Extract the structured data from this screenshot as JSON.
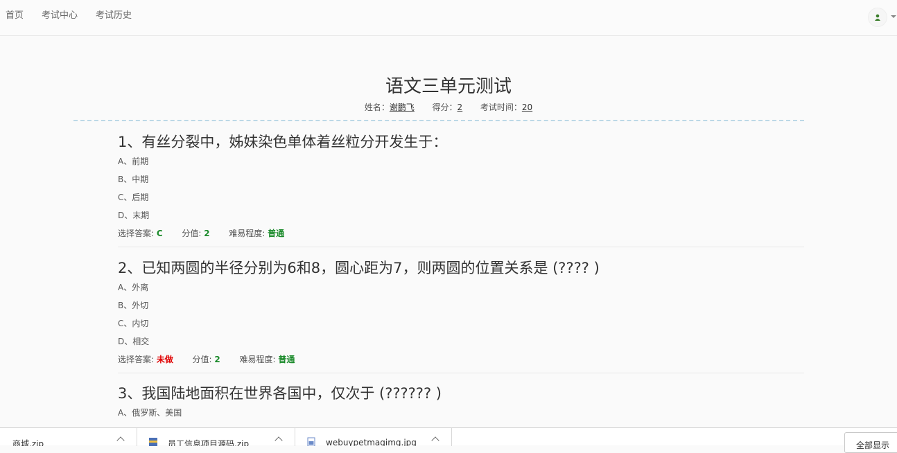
{
  "nav": {
    "home": "首页",
    "exam_center": "考试中心",
    "exam_history": "考试历史"
  },
  "exam": {
    "title": "语文三单元测试",
    "name_label": "姓名：",
    "name_value": "谢鹏飞",
    "score_label": "得分：",
    "score_value": "2",
    "time_label": "考试时间：",
    "time_value": "20"
  },
  "labels": {
    "selected_answer": "选择答案:",
    "score": "分值:",
    "difficulty": "难易程度:"
  },
  "questions": [
    {
      "title": "1、有丝分裂中，姊妹染色单体着丝粒分开发生于：",
      "options": [
        "A、前期",
        "B、中期",
        "C、后期",
        "D、末期"
      ],
      "answer": "C",
      "score": "2",
      "difficulty": "普通"
    },
    {
      "title": "2、已知两圆的半径分别为6和8，圆心距为7，则两圆的位置关系是 (???? )",
      "options": [
        "A、外离",
        "B、外切",
        "C、内切",
        "D、相交"
      ],
      "answer": "未做",
      "score": "2",
      "difficulty": "普通"
    },
    {
      "title": "3、我国陆地面积在世界各国中，仅次于 (?????? )",
      "options": [
        "A、俄罗斯、美国"
      ]
    }
  ],
  "downloads": {
    "items": [
      "商城.zip",
      "员工信息项目源码.zip",
      "webuypetmagimg.jpg"
    ],
    "show_all": "全部显示"
  },
  "colors": {
    "green": "#1a8a2a",
    "red": "#e00000",
    "avatar": "#3a7d2a"
  }
}
